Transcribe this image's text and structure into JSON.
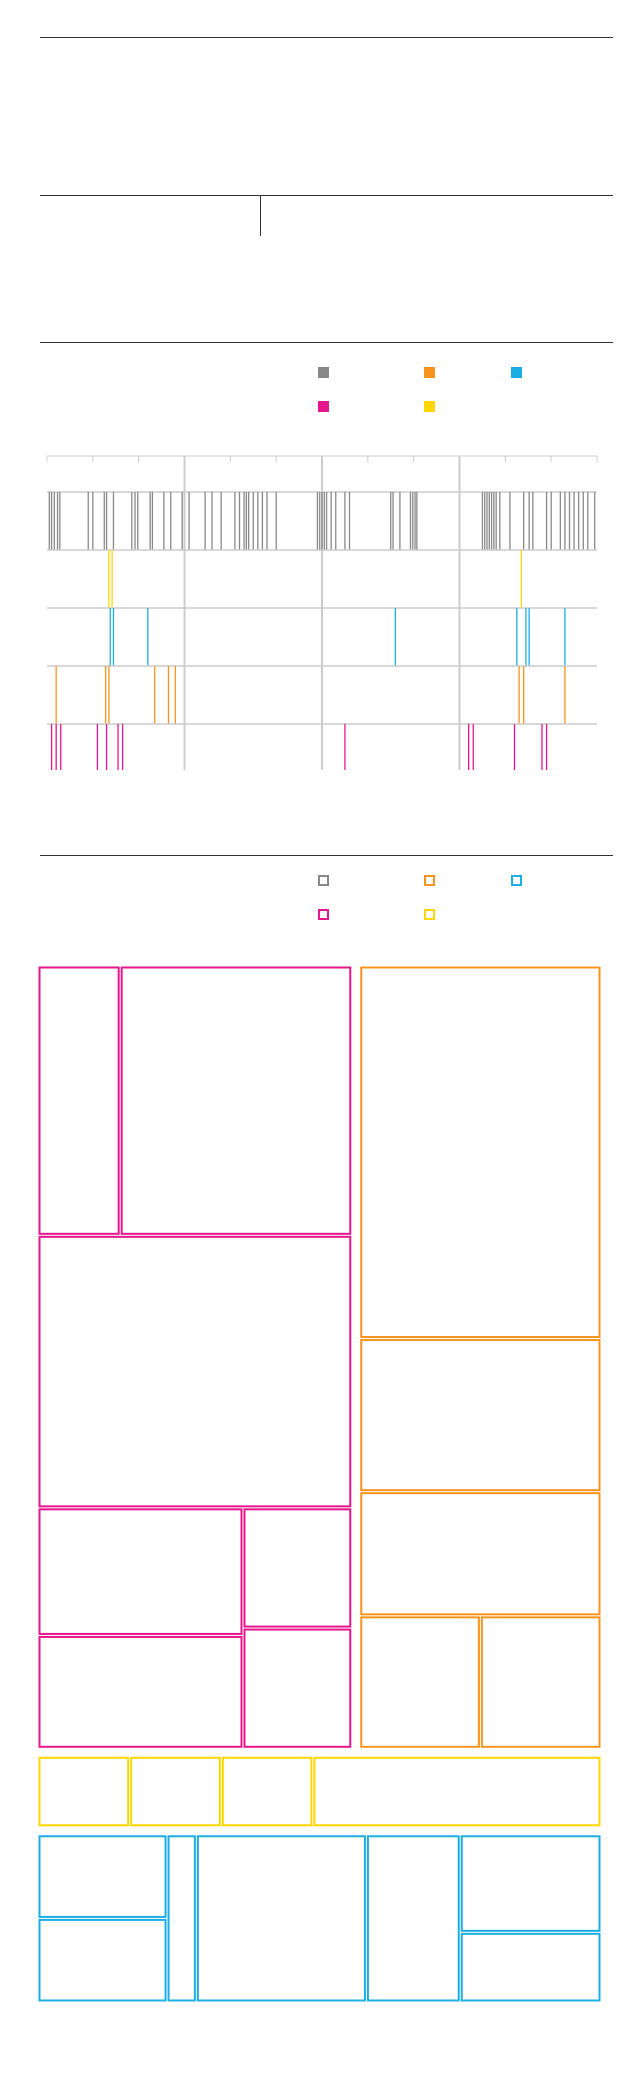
{
  "colors": {
    "gray": "#888888",
    "orange": "#f7941d",
    "blue": "#1aaee5",
    "magenta": "#e6168c",
    "yellow": "#ffd600",
    "grid": "#cccccc",
    "rule": "#333333"
  },
  "legend_solid": [
    {
      "color": "#888888"
    },
    {
      "color": "#f7941d"
    },
    {
      "color": "#1aaee5"
    },
    {
      "color": "#e6168c"
    },
    {
      "color": "#ffd600"
    }
  ],
  "legend_hollow": [
    {
      "color": "#888888"
    },
    {
      "color": "#f7941d"
    },
    {
      "color": "#1aaee5"
    },
    {
      "color": "#e6168c"
    },
    {
      "color": "#ffd600"
    }
  ],
  "chart_data": [
    {
      "type": "strip",
      "x_range": [
        0,
        120
      ],
      "major_ticks": [
        30,
        60,
        90
      ],
      "minor_ticks": [
        0,
        10,
        20,
        40,
        50,
        70,
        80,
        100,
        110,
        120
      ],
      "series": [
        {
          "color": "#888888",
          "values": [
            0.5,
            1.0,
            1.6,
            2.3,
            2.8,
            9,
            10,
            12.5,
            13,
            14.5,
            18.5,
            19.2,
            19.8,
            22.5,
            23,
            25.5,
            27,
            29.5,
            31,
            34.5,
            36,
            38,
            41,
            42,
            43,
            43.5,
            44,
            45,
            46,
            47,
            48,
            50,
            59,
            59.5,
            60,
            60.5,
            61,
            62,
            63,
            65,
            66,
            75,
            75.5,
            77,
            79.3,
            79.8,
            80.3,
            80.7,
            95,
            95.5,
            96,
            96.5,
            97,
            97.5,
            98,
            98.8,
            101,
            104,
            105.2,
            106,
            109,
            110,
            112,
            113,
            114,
            115,
            116,
            117,
            118,
            119.5
          ]
        },
        {
          "color": "#ffd600",
          "values": [
            13.5,
            14.2,
            103.5
          ]
        },
        {
          "color": "#1aaee5",
          "values": [
            13.8,
            14.5,
            22,
            76,
            102.5,
            104.5,
            105.2,
            113
          ]
        },
        {
          "color": "#f7941d",
          "values": [
            2,
            12.8,
            13.5,
            23.5,
            26.5,
            28,
            103,
            104,
            113
          ]
        },
        {
          "color": "#e6168c",
          "values": [
            1,
            2,
            3,
            11,
            13,
            15.5,
            16.5,
            65,
            92,
            93,
            102,
            108,
            109
          ]
        }
      ]
    },
    {
      "type": "treemap",
      "groups": [
        {
          "color": "#e6168c",
          "values": [
            22,
            62,
            85,
            26,
            23,
            13,
            13
          ]
        },
        {
          "color": "#f7941d",
          "values": [
            90,
            37,
            30,
            16,
            16
          ]
        },
        {
          "color": "#ffd600",
          "values": [
            7,
            7,
            7,
            22
          ]
        },
        {
          "color": "#1aaee5",
          "values": [
            11,
            11,
            5,
            29,
            16,
            14,
            10
          ]
        }
      ]
    }
  ]
}
